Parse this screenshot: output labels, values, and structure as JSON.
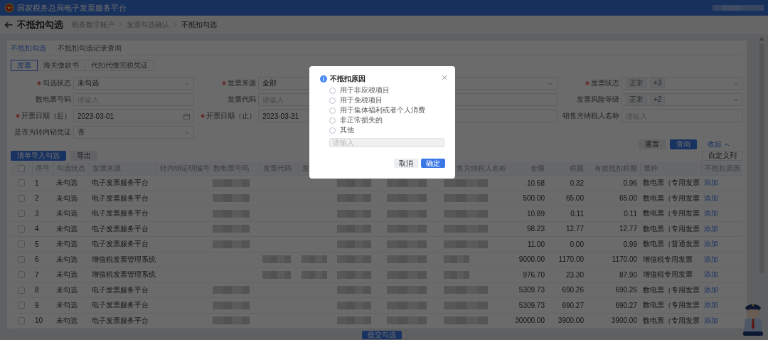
{
  "header": {
    "title": "国家税务总局电子发票服务平台"
  },
  "page": {
    "title": "不抵扣勾选",
    "breadcrumbs": [
      "税务数字账户",
      "发票勾选确认",
      "不抵扣勾选"
    ]
  },
  "tabs": [
    {
      "label": "不抵扣勾选",
      "selected": true
    },
    {
      "label": "不抵扣勾选记录查询",
      "selected": false
    }
  ],
  "doc_types": [
    {
      "label": "发票",
      "selected": true
    },
    {
      "label": "海关缴款书",
      "selected": false
    },
    {
      "label": "代扣代缴完税凭证",
      "selected": false
    }
  ],
  "filters": [
    {
      "label": "勾选状态",
      "required": true,
      "kind": "select",
      "value": "未勾选"
    },
    {
      "label": "发票来源",
      "required": true,
      "kind": "select",
      "value": "全部"
    },
    {
      "label": "发票状态",
      "required": true,
      "kind": "tags",
      "tags": [
        "正常",
        "+3"
      ]
    },
    {
      "label": "数电票号码",
      "required": false,
      "kind": "text",
      "placeholder": "请输入"
    },
    {
      "label": "发票代码",
      "required": false,
      "kind": "text",
      "placeholder": "请输入"
    },
    {
      "label": "发票风险等级",
      "required": false,
      "kind": "tags",
      "tags": [
        "正常",
        "+2"
      ]
    },
    {
      "label": "开票日期（起）",
      "required": true,
      "kind": "date",
      "value": "2023-03-01",
      "icon": true
    },
    {
      "label": "开票日期（止）",
      "required": true,
      "kind": "date",
      "value": "2023-03-31",
      "icon": false
    },
    {
      "label": "销售方纳税人名称",
      "required": false,
      "kind": "text",
      "placeholder": "请输入"
    },
    {
      "label": "是否为转内销凭证",
      "required": false,
      "kind": "select",
      "value": "否"
    }
  ],
  "form_actions": [
    {
      "label": "重置",
      "kind": "default"
    },
    {
      "label": "查询",
      "kind": "primary"
    },
    {
      "label": "收起",
      "kind": "link"
    }
  ],
  "toolbar": {
    "left": [
      {
        "label": "清单导入勾选",
        "kind": "primary"
      },
      {
        "label": "导出",
        "kind": "default"
      }
    ],
    "right": [
      {
        "label": "自定义列",
        "kind": "outline"
      }
    ]
  },
  "table": {
    "all_checked": false,
    "columns": [
      "序号",
      "勾选状态",
      "发票来源",
      "转内销证明编号",
      "数电票号码",
      "发票代码",
      "发",
      "售方纳税人名称",
      "金额",
      "税额",
      "有效抵扣税额",
      "票种",
      "不抵扣原因"
    ],
    "rows": [
      {
        "checked": false,
        "kind": "digital",
        "number": "1",
        "status": "未勾选",
        "source": "电子发票服务平台",
        "amount": "10.68",
        "tax": "0.32",
        "deductible_tax": "0.96",
        "invoice_type": "数电票（专用发票",
        "reason_action": "添加"
      },
      {
        "checked": false,
        "kind": "digital",
        "number": "2",
        "status": "未勾选",
        "source": "电子发票服务平台",
        "amount": "500.00",
        "tax": "65.00",
        "deductible_tax": "65.00",
        "invoice_type": "数电票（专用发票",
        "reason_action": "添加"
      },
      {
        "checked": false,
        "kind": "digital",
        "number": "3",
        "status": "未勾选",
        "source": "电子发票服务平台",
        "amount": "10.89",
        "tax": "0.11",
        "deductible_tax": "0.11",
        "invoice_type": "数电票（专用发票",
        "reason_action": "添加"
      },
      {
        "checked": false,
        "kind": "digital",
        "number": "4",
        "status": "未勾选",
        "source": "电子发票服务平台",
        "amount": "98.23",
        "tax": "12.77",
        "deductible_tax": "12.77",
        "invoice_type": "数电票（专用发票",
        "reason_action": "添加"
      },
      {
        "checked": false,
        "kind": "digital",
        "number": "5",
        "status": "未勾选",
        "source": "电子发票服务平台",
        "amount": "11.00",
        "tax": "0.00",
        "deductible_tax": "0.99",
        "invoice_type": "数电票（普通发票",
        "reason_action": "添加"
      },
      {
        "checked": false,
        "kind": "paper",
        "number": "6",
        "status": "未勾选",
        "source": "增值税发票管理系统",
        "amount": "9000.00",
        "tax": "1170.00",
        "deductible_tax": "1170.00",
        "invoice_type": "增值税专用发票",
        "reason_action": "添加"
      },
      {
        "checked": false,
        "kind": "paper",
        "number": "7",
        "status": "未勾选",
        "source": "增值税发票管理系统",
        "amount": "976.70",
        "tax": "23.30",
        "deductible_tax": "87.90",
        "invoice_type": "增值税专用发票",
        "reason_action": "添加"
      },
      {
        "checked": false,
        "kind": "digital",
        "number": "8",
        "status": "未勾选",
        "source": "电子发票服务平台",
        "amount": "5309.73",
        "tax": "690.26",
        "deductible_tax": "690.26",
        "invoice_type": "数电票（专用发票",
        "reason_action": "添加"
      },
      {
        "checked": false,
        "kind": "digital",
        "number": "9",
        "status": "未勾选",
        "source": "电子发票服务平台",
        "amount": "5309.73",
        "tax": "690.27",
        "deductible_tax": "690.27",
        "invoice_type": "数电票（专用发票",
        "reason_action": "添加"
      },
      {
        "checked": false,
        "kind": "digital",
        "number": "10",
        "status": "未勾选",
        "source": "电子发票服务平台",
        "amount": "30000.00",
        "tax": "3900.00",
        "deductible_tax": "3900.00",
        "invoice_type": "数电票（专用发票",
        "reason_action": "添加"
      }
    ]
  },
  "submit": {
    "label": "提交勾选"
  },
  "dialog": {
    "title": "不抵扣原因",
    "options": [
      {
        "label": "用于非应税项目",
        "selected": false
      },
      {
        "label": "用于免税项目",
        "selected": false
      },
      {
        "label": "用于集体福利或者个人消费",
        "selected": false
      },
      {
        "label": "非正常损失的",
        "selected": false
      },
      {
        "label": "其他",
        "selected": false
      }
    ],
    "other_input": {
      "placeholder": "请输入",
      "disabled": true
    },
    "buttons": [
      {
        "label": "取消",
        "kind": "default"
      },
      {
        "label": "确定",
        "kind": "primary"
      }
    ]
  }
}
